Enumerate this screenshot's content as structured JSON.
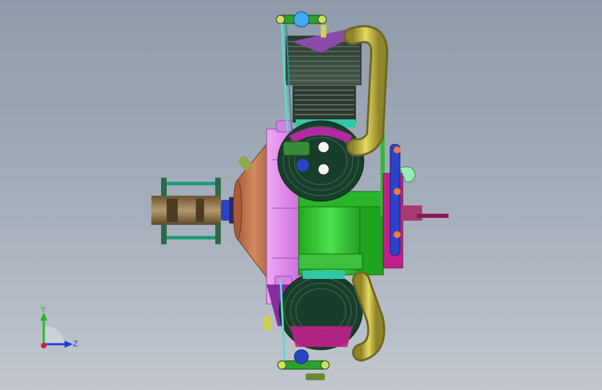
{
  "viewport": {
    "background_top": "#8f9bac",
    "background_bottom": "#c2c7ce"
  },
  "triad": {
    "y_label": "Y",
    "z_label": "Z",
    "y_color": "#21b821",
    "z_color": "#1e3cd8",
    "x_color": "#d62020"
  },
  "model": {
    "colors": {
      "crankcase": "#e58cf0",
      "nose_cone": "#c6784e",
      "cylinder_body": "#22c822",
      "cylinder_head": "#1a4a30",
      "fins": "#3a4a3a",
      "exhaust_pipe": "#c4b83c",
      "rocker_arm": "#2ea02e",
      "spark_plug": "#44aaee",
      "prop_hub": "#8a7048",
      "shaft_ring": "#2a44c8",
      "rear_cover": "#2a44c8",
      "magenta_base": "#c0208a"
    }
  }
}
